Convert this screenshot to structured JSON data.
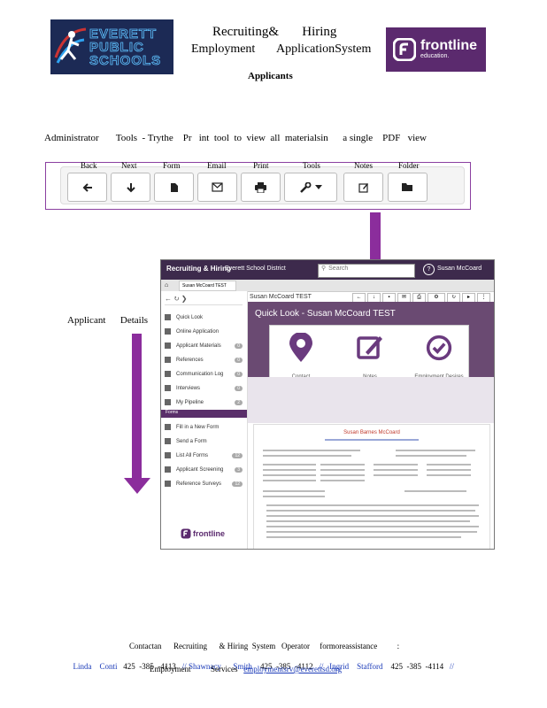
{
  "header": {
    "title_line1": "Recruiting&       Hiring",
    "title_line2": "Employment       ApplicationSystem",
    "subtitle": "Applicants",
    "eps_logo_text": [
      "EVERETT",
      "PUBLIC",
      "SCHOOLS"
    ],
    "frontline_logo_text": "frontline",
    "frontline_logo_sub": "education."
  },
  "intro": {
    "admin_tools_text": "Administrator       Tools  - Trythe    Pr   int  tool  to  view  all  materialsin      a single    PDF   view"
  },
  "toolbar": {
    "labels": [
      "Back",
      "Next",
      "Form",
      "Email",
      "Print",
      "Tools",
      "Notes",
      "Folder"
    ],
    "icons": [
      "arrow-left-icon",
      "arrow-down-icon",
      "document-icon",
      "envelope-icon",
      "printer-icon",
      "wrench-icon",
      "edit-icon",
      "folder-icon"
    ]
  },
  "applicant_details_label": "Applicant      Details",
  "screenshot": {
    "app_title": "Recruiting & Hiring",
    "district": "Everett School District",
    "search_placeholder": "Search",
    "user": "Susan McCoard",
    "tab_label": "Susan McCoard TEST",
    "applicant_name": "Susan McCoard TEST",
    "quick_look_title": "Quick Look - Susan McCoard TEST",
    "quick_look_items": [
      "Contact",
      "Notes",
      "Employment Desires"
    ],
    "sidebar_items": [
      {
        "label": "Quick Look",
        "count": ""
      },
      {
        "label": "Online Application",
        "count": ""
      },
      {
        "label": "Applicant Materials",
        "count": "0"
      },
      {
        "label": "References",
        "count": "0"
      },
      {
        "label": "Communication Log",
        "count": "0"
      },
      {
        "label": "Interviews",
        "count": "0"
      },
      {
        "label": "My Pipeline",
        "count": "2"
      }
    ],
    "forms_header": "Forms",
    "form_items": [
      {
        "label": "Fill in a New Form",
        "count": ""
      },
      {
        "label": "Send a Form",
        "count": ""
      },
      {
        "label": "List All Forms",
        "count": "12"
      },
      {
        "label": "Applicant Screening",
        "count": "3"
      },
      {
        "label": "Reference Surveys",
        "count": "12"
      }
    ],
    "resume_name": "Susan Barnes McCoard",
    "footer_brand": "frontline",
    "footer_brand_sub": "education"
  },
  "footer": {
    "line1": "Contactan      Recruiting      & Hiring  System   Operator     formoreassistance          :",
    "contacts": [
      {
        "name": "Linda    Conti",
        "phone": "425  -385  -4113"
      },
      {
        "name": "Shawnacy      Smith",
        "phone": "425  -385  -4112"
      },
      {
        "name": "Ingrid    Stafford",
        "phone": "425  -385  -4114"
      }
    ],
    "line3_prefix": "Employment          Services",
    "email": "employmentsrv@everettsd.org"
  },
  "colors": {
    "purple_arrow": "#8b2d9c",
    "frontline_purple": "#5b2a6e",
    "eps_navy": "#1c2a55",
    "link_blue": "#1a3ab8"
  }
}
